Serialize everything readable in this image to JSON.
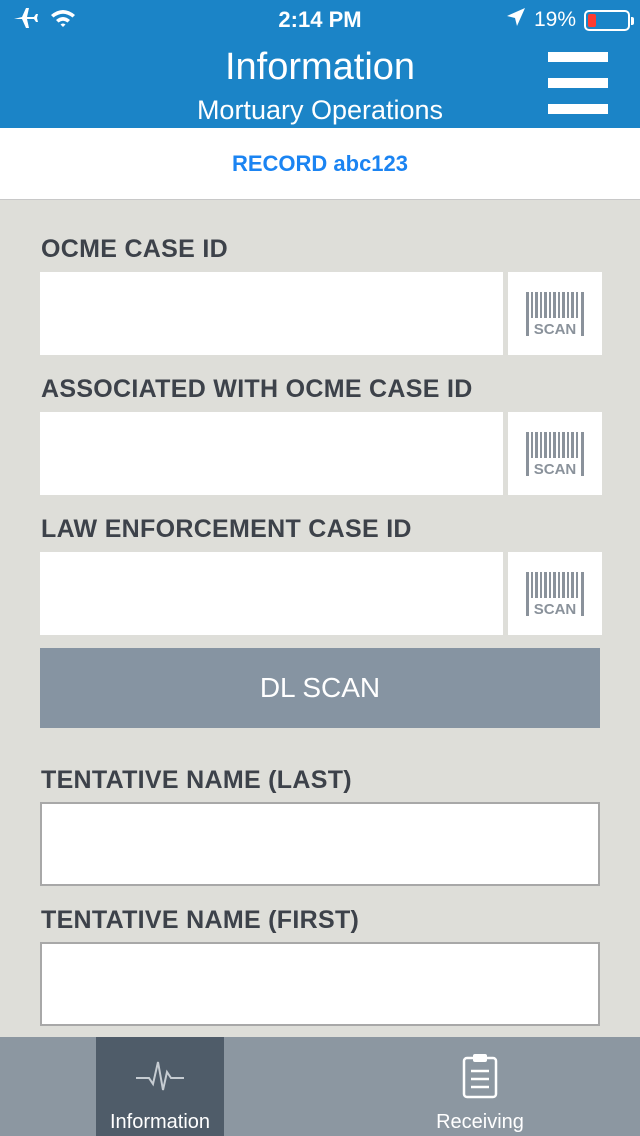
{
  "status_bar": {
    "time": "2:14 PM",
    "battery_text": "19%",
    "battery_level": 0.19,
    "icons": [
      "airplane-icon",
      "wifi-icon",
      "location-arrow-icon",
      "battery-icon"
    ]
  },
  "header": {
    "title": "Information",
    "subtitle": "Mortuary Operations",
    "menu_icon": "hamburger-menu-icon"
  },
  "record": {
    "label": "RECORD abc123"
  },
  "form": {
    "ocme_case_id": {
      "label": "OCME CASE ID",
      "value": "",
      "scan_label": "SCAN"
    },
    "associated_ocme_case_id": {
      "label": "ASSOCIATED WITH OCME CASE ID",
      "value": "",
      "scan_label": "SCAN"
    },
    "law_enforcement_case_id": {
      "label": "LAW ENFORCEMENT CASE ID",
      "value": "",
      "scan_label": "SCAN"
    },
    "dl_scan_label": "DL SCAN",
    "tentative_last": {
      "label": "TENTATIVE NAME (LAST)",
      "value": ""
    },
    "tentative_first": {
      "label": "TENTATIVE NAME (FIRST)",
      "value": ""
    }
  },
  "tabs": [
    {
      "label": "Information",
      "icon": "pulse-icon",
      "active": true
    },
    {
      "label": "Receiving",
      "icon": "clipboard-icon",
      "active": false
    }
  ],
  "colors": {
    "header_bg": "#1b84c7",
    "record_text": "#1b84f2",
    "page_bg": "#deded9",
    "dl_scan_bg": "#8694a2",
    "tabbar_bg": "#8c97a1",
    "tab_active_bg": "#4f5c69",
    "battery_low": "#ff3b30"
  }
}
